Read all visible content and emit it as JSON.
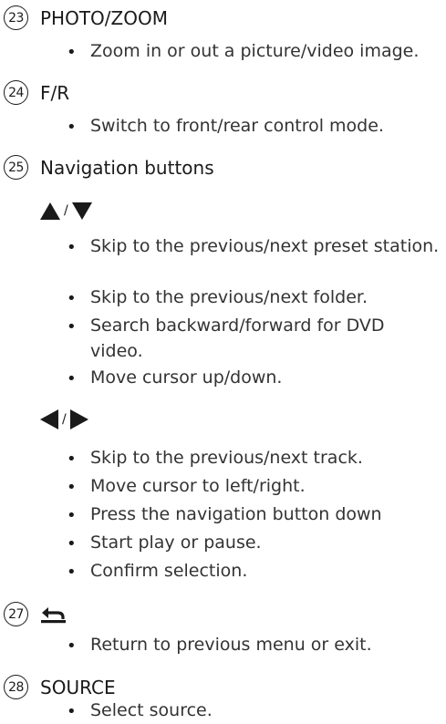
{
  "sections": [
    {
      "number": "23",
      "title": "PHOTO/ZOOM",
      "bullets": [
        "Zoom in or out a picture/video image."
      ]
    },
    {
      "number": "24",
      "title": "F/R",
      "bullets": [
        "Switch to front/rear control mode."
      ]
    },
    {
      "number": "25",
      "title": "Navigation buttons"
    },
    {
      "number": "27",
      "title": "",
      "bullets": [
        "Return to previous menu or exit."
      ]
    },
    {
      "number": "28",
      "title": "SOURCE",
      "bullets": [
        "Select source."
      ]
    }
  ],
  "up_down": {
    "separator": "/",
    "bullets": [
      "Skip to the previous/next preset station.",
      "Skip to the previous/next folder.",
      "Search backward/forward for DVD video.",
      "Move cursor up/down."
    ]
  },
  "left_right": {
    "separator": "/",
    "bullets": [
      "Skip to the previous/next track.",
      "Move cursor to left/right.",
      "Press the navigation button down",
      "Start play or pause.",
      "Confirm selection."
    ]
  },
  "bullet_char": "•",
  "icons": {
    "up": "up-triangle-icon",
    "down": "down-triangle-icon",
    "left": "left-triangle-icon",
    "right": "right-triangle-icon",
    "back": "return-arrow-icon"
  }
}
